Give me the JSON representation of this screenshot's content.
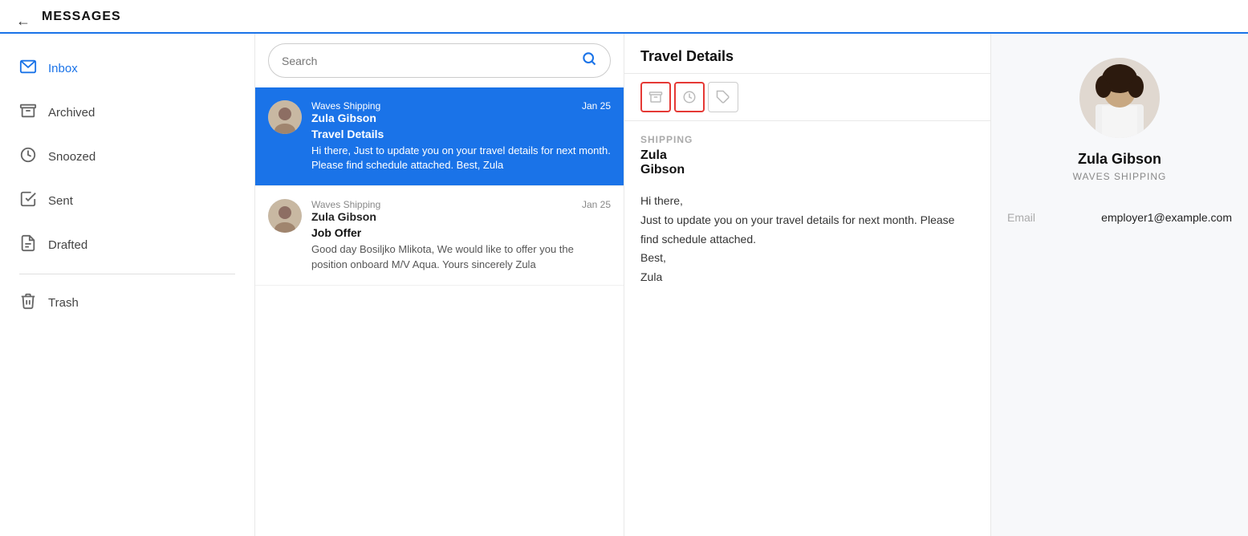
{
  "header": {
    "back_icon": "←",
    "title": "MESSAGES"
  },
  "sidebar": {
    "items": [
      {
        "id": "inbox",
        "label": "Inbox",
        "icon": "inbox",
        "active": true
      },
      {
        "id": "archived",
        "label": "Archived",
        "icon": "archive",
        "active": false
      },
      {
        "id": "snoozed",
        "label": "Snoozed",
        "icon": "clock",
        "active": false
      },
      {
        "id": "sent",
        "label": "Sent",
        "icon": "sent",
        "active": false
      },
      {
        "id": "drafted",
        "label": "Drafted",
        "icon": "draft",
        "active": false
      },
      {
        "id": "trash",
        "label": "Trash",
        "icon": "trash",
        "active": false
      }
    ]
  },
  "search": {
    "placeholder": "Search",
    "icon": "🔍"
  },
  "messages": [
    {
      "id": "msg1",
      "from": "Waves Shipping",
      "sender_name": "Zula Gibson",
      "date": "Jan 25",
      "subject": "Travel Details",
      "preview": "Hi there, Just to update you on your travel details for next month. Please find schedule attached. Best, Zula",
      "selected": true
    },
    {
      "id": "msg2",
      "from": "Waves Shipping",
      "sender_name": "Zula Gibson",
      "date": "Jan 25",
      "subject": "Job Offer",
      "preview": "Good day Bosiljko Mlikota, We would like to offer you the position onboard M/V Aqua. Yours sincerely Zula",
      "selected": false
    }
  ],
  "detail": {
    "title": "Travel Details",
    "actions": [
      {
        "id": "archive",
        "icon": "archive",
        "highlighted": true
      },
      {
        "id": "clock",
        "icon": "clock",
        "highlighted": true
      },
      {
        "id": "tag",
        "icon": "tag",
        "highlighted": false
      }
    ],
    "shipping_label": "SHIPPING",
    "sender_name_line1": "Zula",
    "sender_name_line2": "Gibson",
    "message": "Hi there,\nJust to update you on your travel details for next month. Please find schedule attached.\nBest,\nZula"
  },
  "contact": {
    "name": "Zula Gibson",
    "company": "WAVES SHIPPING",
    "email_label": "Email",
    "email_value": "employer1@example.com"
  }
}
